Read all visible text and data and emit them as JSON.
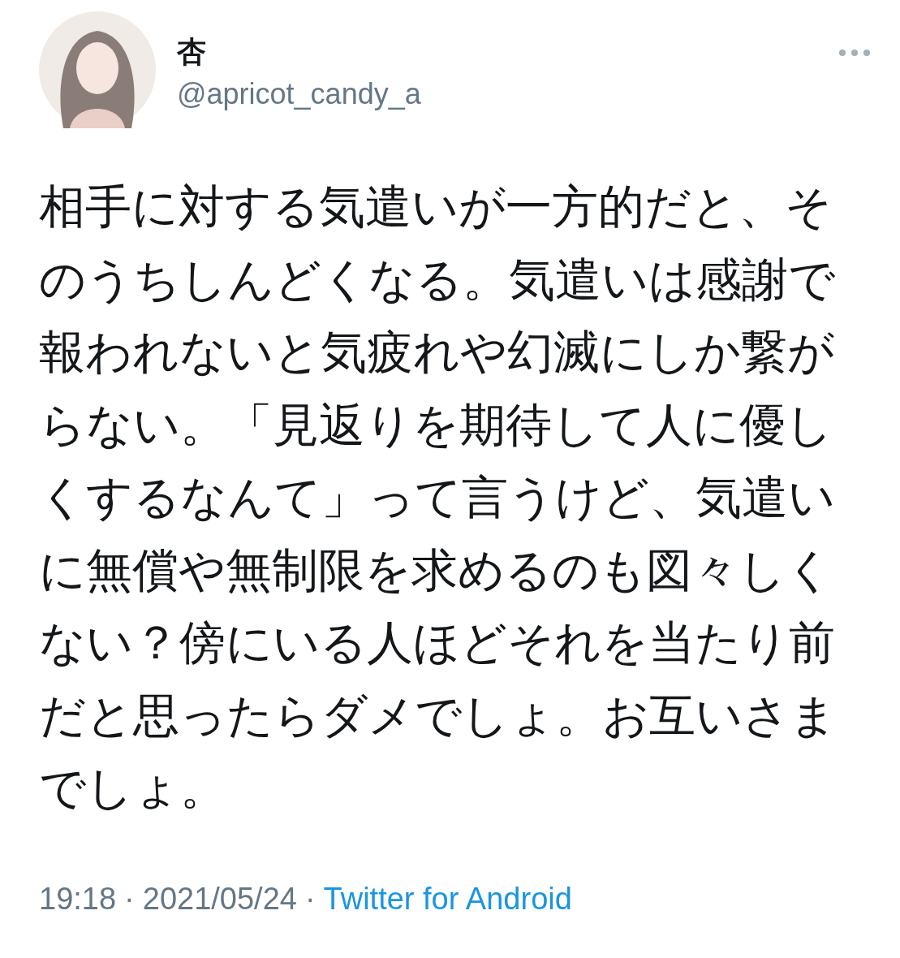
{
  "author": {
    "name": "杏",
    "handle": "@apricot_candy_a"
  },
  "text": "相手に対する気遣いが一方的だと、そのうちしんどくなる。気遣いは感謝で報われないと気疲れや幻滅にしか繋がらない。「見返りを期待して人に優しくするなんて」って言うけど、気遣いに無償や無制限を求めるのも図々しくない？傍にいる人ほどそれを当たり前だと思ったらダメでしょ。お互いさまでしょ。",
  "meta": {
    "time": "19:18",
    "separators": [
      "·",
      "·"
    ],
    "date": "2021/05/24",
    "source": "Twitter for Android"
  }
}
